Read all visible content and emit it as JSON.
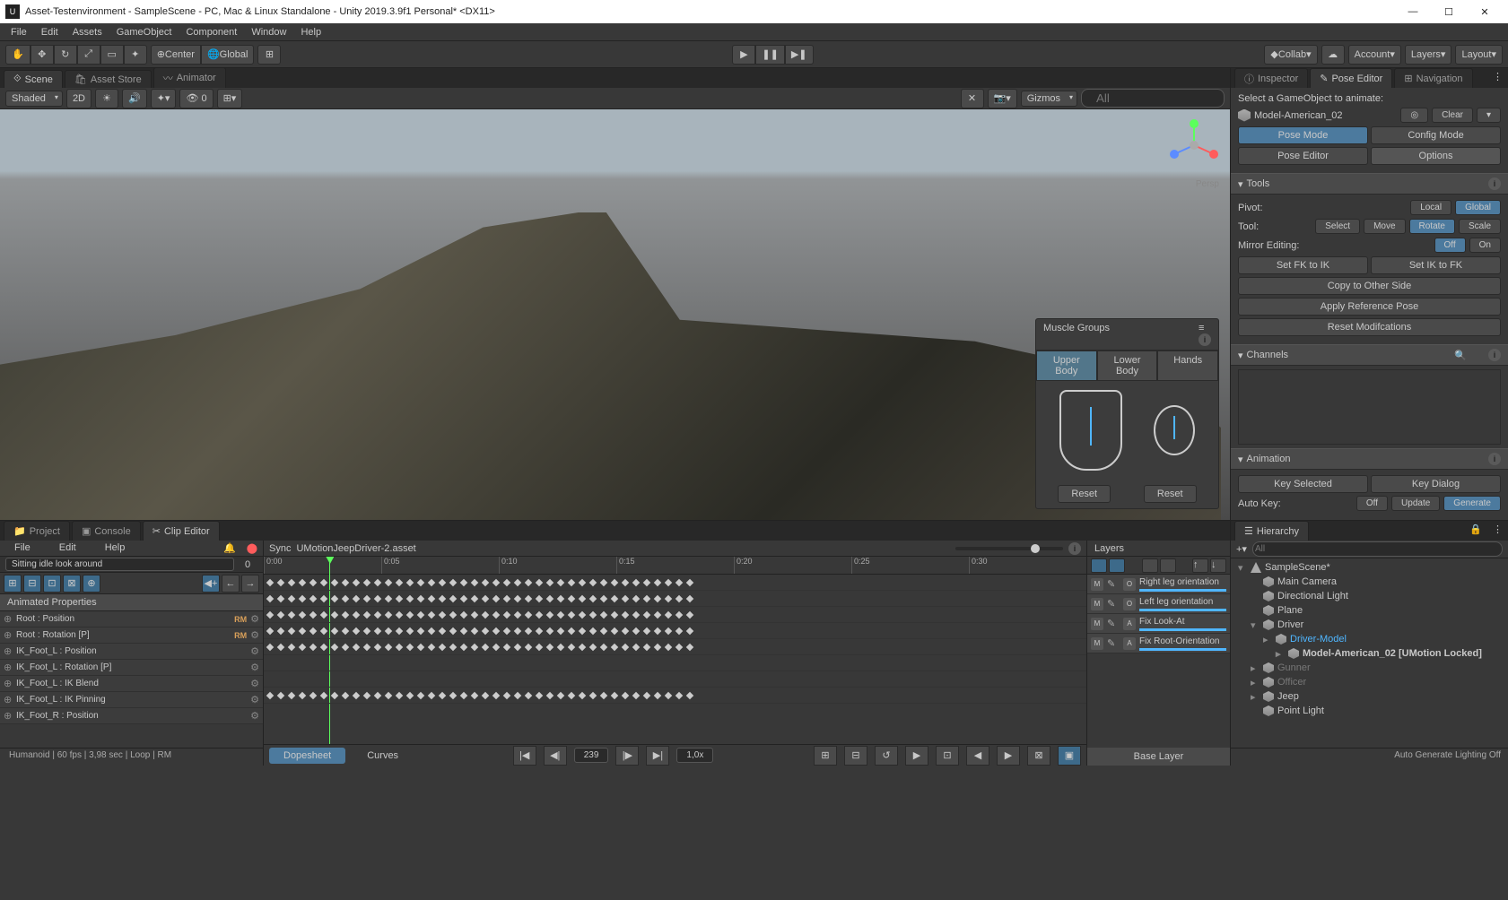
{
  "window_title": "Asset-Testenvironment - SampleScene - PC, Mac & Linux Standalone - Unity 2019.3.9f1 Personal* <DX11>",
  "menus": [
    "File",
    "Edit",
    "Assets",
    "GameObject",
    "Component",
    "Window",
    "Help"
  ],
  "toolbar": {
    "center": "Center",
    "global": "Global",
    "collab": "Collab",
    "account": "Account",
    "layers": "Layers",
    "layout": "Layout"
  },
  "scene_tabs": {
    "scene": "Scene",
    "asset_store": "Asset Store",
    "animator": "Animator"
  },
  "scene_toolbar": {
    "shading": "Shaded",
    "mode2d": "2D",
    "gizmos": "Gizmos",
    "search_placeholder": "All",
    "persp": "Persp"
  },
  "muscle": {
    "title": "Muscle Groups",
    "upper": "Upper Body",
    "lower": "Lower Body",
    "hands": "Hands",
    "reset": "Reset"
  },
  "inspector_tabs": {
    "inspector": "Inspector",
    "pose_editor": "Pose Editor",
    "navigation": "Navigation"
  },
  "pose": {
    "prompt": "Select a GameObject to animate:",
    "obj": "Model-American_02",
    "clear": "Clear",
    "pose_mode": "Pose Mode",
    "config_mode": "Config Mode",
    "tab_pose": "Pose Editor",
    "tab_options": "Options"
  },
  "tools": {
    "title": "Tools",
    "pivot": "Pivot:",
    "local": "Local",
    "global": "Global",
    "tool": "Tool:",
    "select": "Select",
    "move": "Move",
    "rotate": "Rotate",
    "scale": "Scale",
    "mirror": "Mirror Editing:",
    "off": "Off",
    "on": "On",
    "fk_ik": "Set FK to IK",
    "ik_fk": "Set IK to FK",
    "copy": "Copy to Other Side",
    "refpose": "Apply Reference Pose",
    "resetmod": "Reset Modifcations"
  },
  "channels": {
    "title": "Channels"
  },
  "animation": {
    "title": "Animation",
    "key_selected": "Key Selected",
    "key_dialog": "Key Dialog",
    "autokey": "Auto Key:",
    "off": "Off",
    "update": "Update",
    "generate": "Generate"
  },
  "bottom_tabs": {
    "project": "Project",
    "console": "Console",
    "clip_editor": "Clip Editor"
  },
  "clip": {
    "menus": [
      "File",
      "Edit",
      "Help"
    ],
    "search_placeholder": "Sitting idle look around",
    "frame_num": "0",
    "sync": "Sync",
    "asset": "UMotionJeepDriver-2.asset",
    "animated_props": "Animated Properties",
    "props": [
      {
        "name": "Root : Position",
        "rm": true
      },
      {
        "name": "Root : Rotation [P]",
        "rm": true
      },
      {
        "name": "IK_Foot_L : Position",
        "rm": false
      },
      {
        "name": "IK_Foot_L : Rotation [P]",
        "rm": false
      },
      {
        "name": "IK_Foot_L : IK Blend",
        "rm": false
      },
      {
        "name": "IK_Foot_L : IK Pinning",
        "rm": false
      },
      {
        "name": "IK_Foot_R : Position",
        "rm": false
      }
    ],
    "ruler": [
      "0:00",
      "0:05",
      "0:10",
      "0:15",
      "0:20",
      "0:25",
      "0:30"
    ],
    "dopesheet": "Dopesheet",
    "curves": "Curves",
    "frames": "239",
    "speed": "1,0x",
    "status": "Humanoid | 60 fps | 3,98 sec | Loop | RM"
  },
  "layers": {
    "title": "Layers",
    "items": [
      {
        "tag": "O",
        "name": "Right leg orientation"
      },
      {
        "tag": "O",
        "name": "Left leg orientation"
      },
      {
        "tag": "A",
        "name": "Fix Look-At"
      },
      {
        "tag": "A",
        "name": "Fix Root-Orientation"
      }
    ],
    "base": "Base Layer"
  },
  "hierarchy": {
    "title": "Hierarchy",
    "search_placeholder": "All",
    "tree": [
      {
        "depth": 0,
        "toggle": "▾",
        "name": "SampleScene*",
        "icon": "unity"
      },
      {
        "depth": 1,
        "toggle": "",
        "name": "Main Camera",
        "icon": "cube"
      },
      {
        "depth": 1,
        "toggle": "",
        "name": "Directional Light",
        "icon": "cube"
      },
      {
        "depth": 1,
        "toggle": "",
        "name": "Plane",
        "icon": "cube"
      },
      {
        "depth": 1,
        "toggle": "▾",
        "name": "Driver",
        "icon": "cube"
      },
      {
        "depth": 2,
        "toggle": "▸",
        "name": "Driver-Model",
        "icon": "cube",
        "sel": true
      },
      {
        "depth": 3,
        "toggle": "▸",
        "name": "Model-American_02 [UMotion Locked]",
        "icon": "cog",
        "selbold": true
      },
      {
        "depth": 1,
        "toggle": "▸",
        "name": "Gunner",
        "icon": "cube",
        "dim": true
      },
      {
        "depth": 1,
        "toggle": "▸",
        "name": "Officer",
        "icon": "cube",
        "dim": true
      },
      {
        "depth": 1,
        "toggle": "▸",
        "name": "Jeep",
        "icon": "cube"
      },
      {
        "depth": 1,
        "toggle": "",
        "name": "Point Light",
        "icon": "cube"
      }
    ],
    "status": "Auto Generate Lighting Off"
  }
}
